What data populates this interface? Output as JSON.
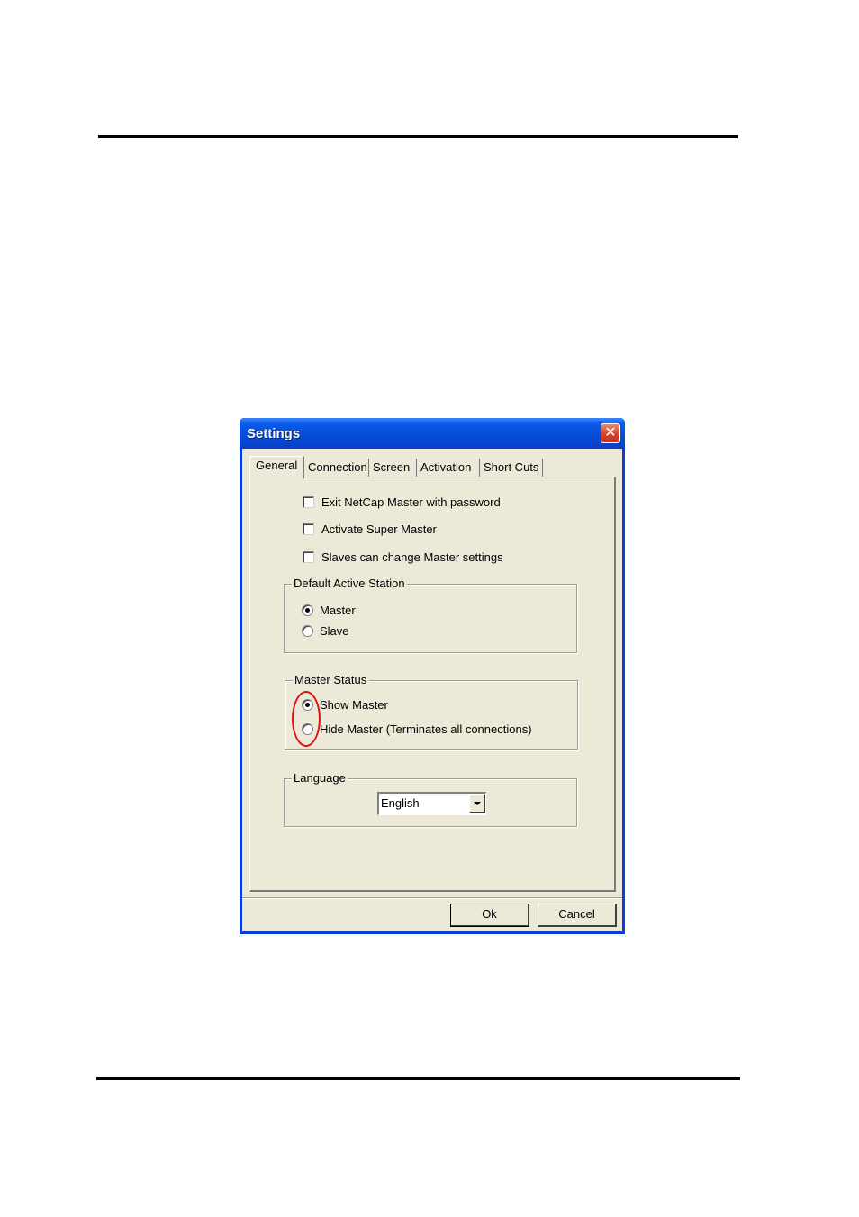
{
  "window": {
    "title": "Settings"
  },
  "tabs": [
    "General",
    "Connection",
    "Screen",
    "Activation",
    "Short Cuts"
  ],
  "general": {
    "checkboxes": [
      {
        "label": "Exit NetCap Master with password",
        "checked": false
      },
      {
        "label": "Activate Super Master",
        "checked": false
      },
      {
        "label": "Slaves can change Master settings",
        "checked": false
      }
    ],
    "default_active_station": {
      "legend": "Default Active Station",
      "options": [
        "Master",
        "Slave"
      ],
      "selected": "Master"
    },
    "master_status": {
      "legend": "Master Status",
      "options": [
        "Show Master",
        "Hide Master (Terminates all connections)"
      ],
      "selected": "Show Master"
    },
    "language": {
      "legend": "Language",
      "value": "English"
    }
  },
  "buttons": {
    "ok": "Ok",
    "cancel": "Cancel"
  },
  "colors": {
    "title_bar": "#0748d3",
    "dialog_bg": "#ece9d8",
    "close_button": "#d0402a",
    "highlight_ellipse": "#e01010"
  },
  "icons": {
    "close": "close-x-icon",
    "dropdown": "chevron-down-icon"
  }
}
